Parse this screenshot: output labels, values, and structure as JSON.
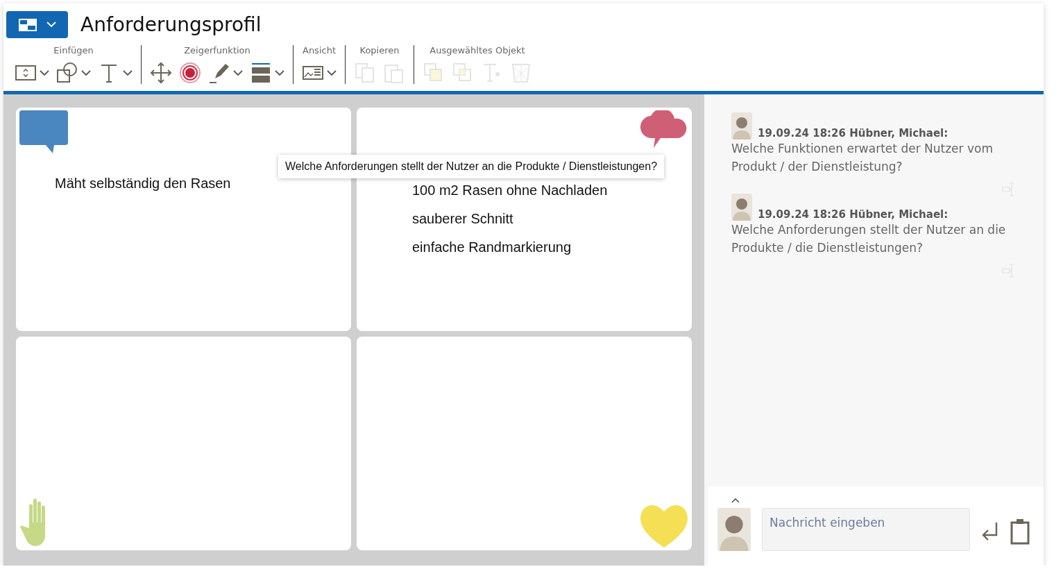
{
  "header": {
    "title": "Anforderungsprofil"
  },
  "toolbar": [
    {
      "label": "Einfügen",
      "tools": [
        {
          "kind": "frame",
          "dropdown": true,
          "disabled": false
        },
        {
          "kind": "shapes",
          "dropdown": true,
          "disabled": false
        },
        {
          "kind": "text",
          "dropdown": true,
          "disabled": false
        }
      ]
    },
    {
      "label": "Zeigerfunktion",
      "tools": [
        {
          "kind": "move",
          "dropdown": false,
          "disabled": false
        },
        {
          "kind": "target",
          "dropdown": false,
          "disabled": false
        },
        {
          "kind": "pen",
          "dropdown": true,
          "disabled": false
        },
        {
          "kind": "linestyle",
          "dropdown": true,
          "disabled": false
        }
      ]
    },
    {
      "label": "Ansicht",
      "tools": [
        {
          "kind": "view",
          "dropdown": true,
          "disabled": false
        }
      ]
    },
    {
      "label": "Kopieren",
      "tools": [
        {
          "kind": "copy",
          "dropdown": false,
          "disabled": true
        },
        {
          "kind": "paste",
          "dropdown": false,
          "disabled": true
        }
      ]
    },
    {
      "label": "Ausgewähltes Objekt",
      "tools": [
        {
          "kind": "front",
          "dropdown": false,
          "disabled": true
        },
        {
          "kind": "back",
          "dropdown": false,
          "disabled": true
        },
        {
          "kind": "textformat",
          "dropdown": false,
          "disabled": true
        },
        {
          "kind": "delete",
          "dropdown": false,
          "disabled": true
        }
      ]
    }
  ],
  "canvas": {
    "quadrants": [
      {
        "kind": "speech",
        "color": "#4a86bf",
        "notes": [
          "Mäht selbständig den Rasen"
        ]
      },
      {
        "kind": "cloud",
        "color": "#cf5f75",
        "notes": [
          "100 m2 Rasen ohne Nachladen",
          "sauberer Schnitt",
          "einfache Randmarkierung"
        ]
      },
      {
        "kind": "hand",
        "color": "#c5d986"
      },
      {
        "kind": "heart",
        "color": "#f5df55"
      }
    ],
    "tooltip": "Welche Anforderungen stellt der Nutzer an die Produkte / Dienstleistungen?"
  },
  "chat": {
    "messages": [
      {
        "meta": "19.09.24 18:26 Hübner, Michael:",
        "text": "Welche Funktionen erwartet der Nutzer vom Produkt / der Dienstleistung?"
      },
      {
        "meta": "19.09.24 18:26 Hübner, Michael:",
        "text": "Welche Anforderungen stellt der Nutzer an die Produkte / die Dienstleistungen?"
      }
    ],
    "input": {
      "placeholder": "Nachricht eingeben"
    }
  }
}
